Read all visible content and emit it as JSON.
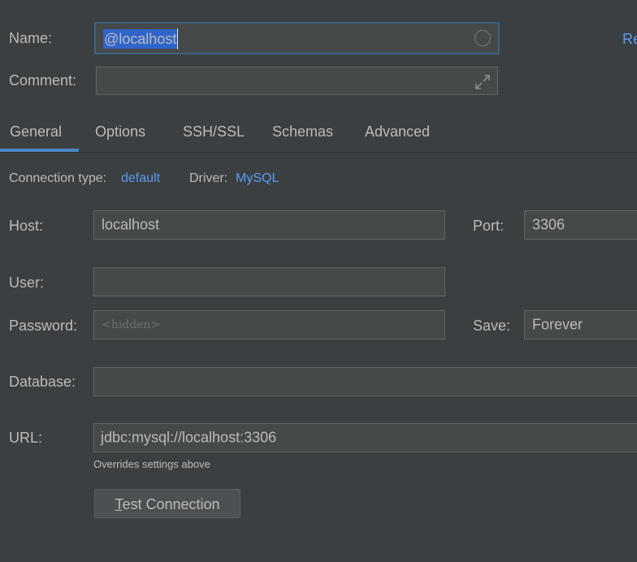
{
  "name": {
    "label": "Name:",
    "value": "@localhost"
  },
  "top_right_link": "Re",
  "comment": {
    "label": "Comment:",
    "value": ""
  },
  "tabs": [
    {
      "label": "General",
      "active": true
    },
    {
      "label": "Options",
      "active": false
    },
    {
      "label": "SSH/SSL",
      "active": false
    },
    {
      "label": "Schemas",
      "active": false
    },
    {
      "label": "Advanced",
      "active": false
    }
  ],
  "connection_type": {
    "label": "Connection type:",
    "value": "default"
  },
  "driver": {
    "label": "Driver:",
    "value": "MySQL"
  },
  "host": {
    "label": "Host:",
    "value": "localhost"
  },
  "port": {
    "label": "Port:",
    "value": "3306"
  },
  "user": {
    "label": "User:",
    "value": ""
  },
  "password": {
    "label": "Password:",
    "placeholder": "<hidden>"
  },
  "save": {
    "label": "Save:",
    "value": "Forever"
  },
  "database": {
    "label": "Database:",
    "value": ""
  },
  "url": {
    "label": "URL:",
    "value": "jdbc:mysql://localhost:3306",
    "hint": "Overrides settings above"
  },
  "test_button": {
    "mnemonic": "T",
    "rest": "est Connection"
  },
  "colors": {
    "background": "#3c3f41",
    "accent": "#4a88c7",
    "link": "#589df6",
    "selection": "#2f65ca"
  },
  "icons": {
    "clear": "circle-icon",
    "expand": "expand-icon"
  }
}
